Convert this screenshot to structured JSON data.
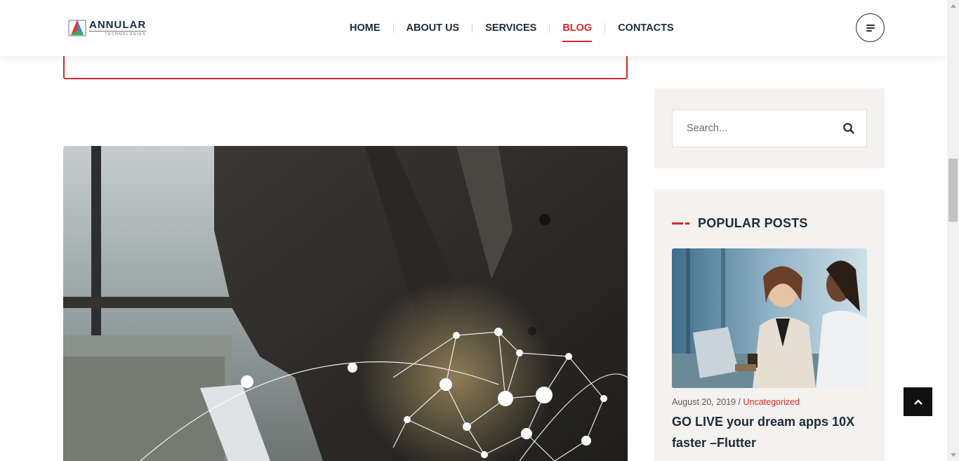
{
  "header": {
    "logo_name": "ANNULAR",
    "logo_sub": "TECHNOLOGIES",
    "nav": [
      {
        "label": "HOME",
        "active": false
      },
      {
        "label": "ABOUT US",
        "active": false
      },
      {
        "label": "SERVICES",
        "active": false
      },
      {
        "label": "BLOG",
        "active": true
      },
      {
        "label": "CONTACTS",
        "active": false
      }
    ],
    "menu_icon": "hamburger-icon"
  },
  "sidebar": {
    "search": {
      "placeholder": "Search...",
      "value": "",
      "icon": "search-icon"
    },
    "popular": {
      "title": "POPULAR POSTS",
      "post": {
        "date": "August 20, 2019",
        "separator": " / ",
        "category": "Uncategorized",
        "title": "GO LIVE your dream apps 10X faster –Flutter"
      }
    }
  },
  "scroll_top_icon": "chevron-up-icon",
  "colors": {
    "accent": "#d52929",
    "dark": "#1c2b39",
    "sidebar_bg": "#f4f2ef"
  }
}
